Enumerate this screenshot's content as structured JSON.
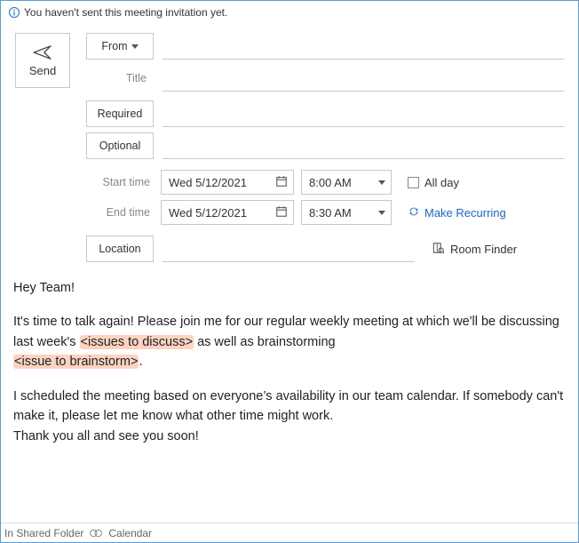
{
  "info_bar": {
    "text": "You haven't sent this meeting invitation yet."
  },
  "send": {
    "label": "Send"
  },
  "fields": {
    "from_label": "From",
    "title_label": "Title",
    "required_label": "Required",
    "optional_label": "Optional",
    "start_label": "Start time",
    "end_label": "End time",
    "location_label": "Location",
    "from_value": "",
    "title_value": "",
    "required_value": "",
    "optional_value": "",
    "location_value": ""
  },
  "start": {
    "date": "Wed 5/12/2021",
    "time": "8:00 AM"
  },
  "end": {
    "date": "Wed 5/12/2021",
    "time": "8:30 AM"
  },
  "allday": {
    "label": "All day",
    "checked": false
  },
  "recurring": {
    "label": "Make Recurring"
  },
  "room_finder": {
    "label": "Room Finder"
  },
  "body": {
    "greeting": "Hey Team!",
    "p2_a": "It's time to talk again! Please join me for our regular weekly meeting at which we'll be discussing last week's ",
    "p2_h1": "<issues to discuss>",
    "p2_b": " as well as brainstorming ",
    "p2_h2": " <issue to brainstorm>",
    "p2_c": ".",
    "p3_a": "I scheduled the meeting based on everyone’s availability in our team calendar. If somebody can't make it, please let me know what other time might work.",
    "p3_b": "Thank you all and see you soon!"
  },
  "status": {
    "folder_label": "In Shared Folder",
    "calendar_label": "Calendar"
  }
}
